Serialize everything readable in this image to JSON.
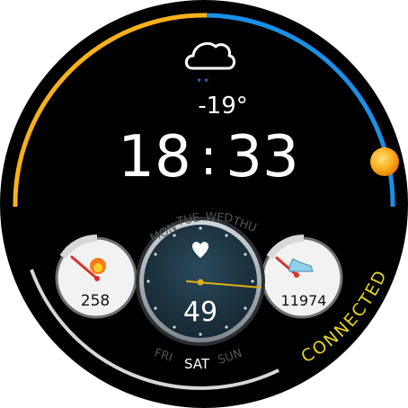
{
  "weather": {
    "icon": "cloud-snow-icon",
    "temperature": "-19°"
  },
  "time": {
    "hours": "18",
    "separator": ":",
    "minutes": "33"
  },
  "days": {
    "top": [
      "MON",
      "TUE",
      "WED",
      "THU"
    ],
    "bottom": [
      "FRI",
      "SAT",
      "SUN"
    ],
    "current": "SAT"
  },
  "heart_rate": {
    "icon": "heart-icon",
    "value": "49"
  },
  "calories": {
    "icon": "flame-icon",
    "value": "258"
  },
  "steps": {
    "icon": "sneaker-icon",
    "value": "11974"
  },
  "status": {
    "label": "CONNECTED"
  },
  "daylight_arc": {
    "icon": "sun-icon"
  },
  "colors": {
    "background": "#000000",
    "ring_yellow": "#f7b21b",
    "ring_blue": "#1a8fe6",
    "accent_yellow": "#e8d51c",
    "needle_red": "#d8322c",
    "center_dial": "#1f3543",
    "gauge_face": "#f2f2f2"
  }
}
